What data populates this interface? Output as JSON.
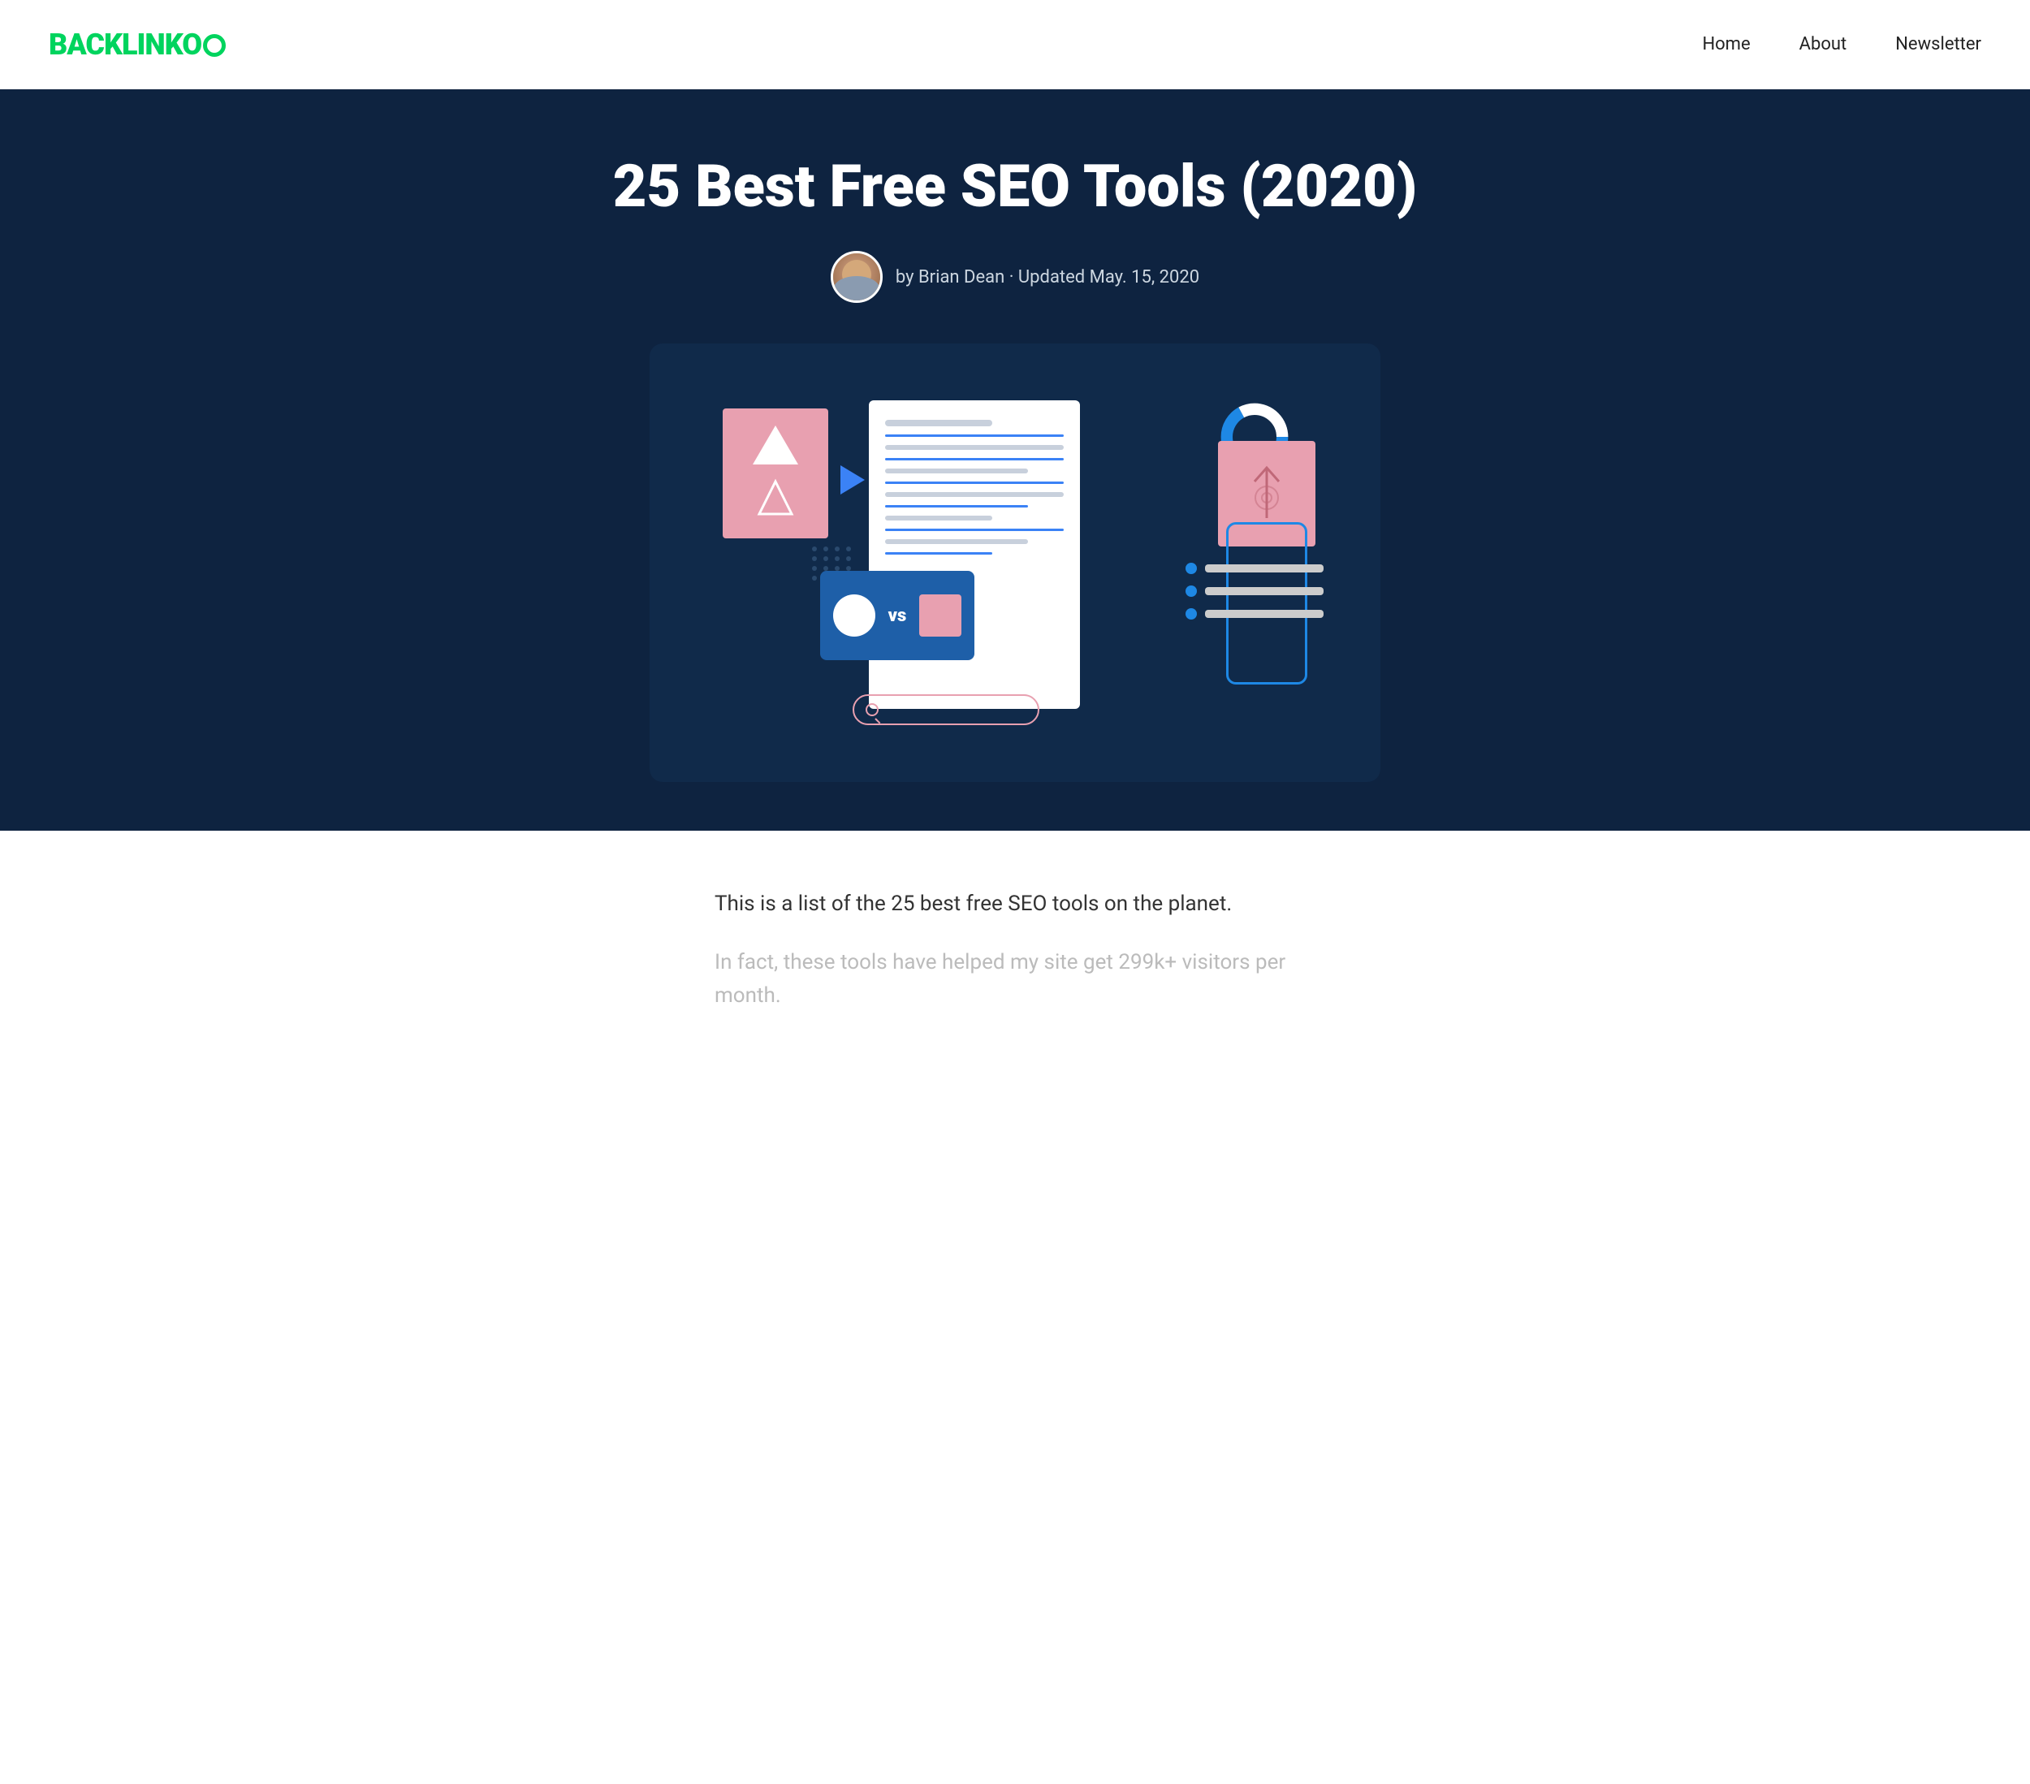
{
  "header": {
    "logo_text": "BACKLINKO",
    "nav": {
      "home": "Home",
      "about": "About",
      "newsletter": "Newsletter"
    }
  },
  "hero": {
    "title": "25 Best Free SEO Tools (2020)",
    "author": {
      "name": "Brian Dean",
      "updated": "Updated May. 15, 2020",
      "byline": "by Brian Dean · Updated May. 15, 2020"
    }
  },
  "content": {
    "intro": "This is a list of the 25 best free SEO tools on the planet.",
    "faded": "In fact, these tools have helped my site get 299k+ visitors per month."
  },
  "colors": {
    "brand_green": "#00d45e",
    "nav_dark": "#0e2340",
    "accent_blue": "#1e88e5"
  }
}
